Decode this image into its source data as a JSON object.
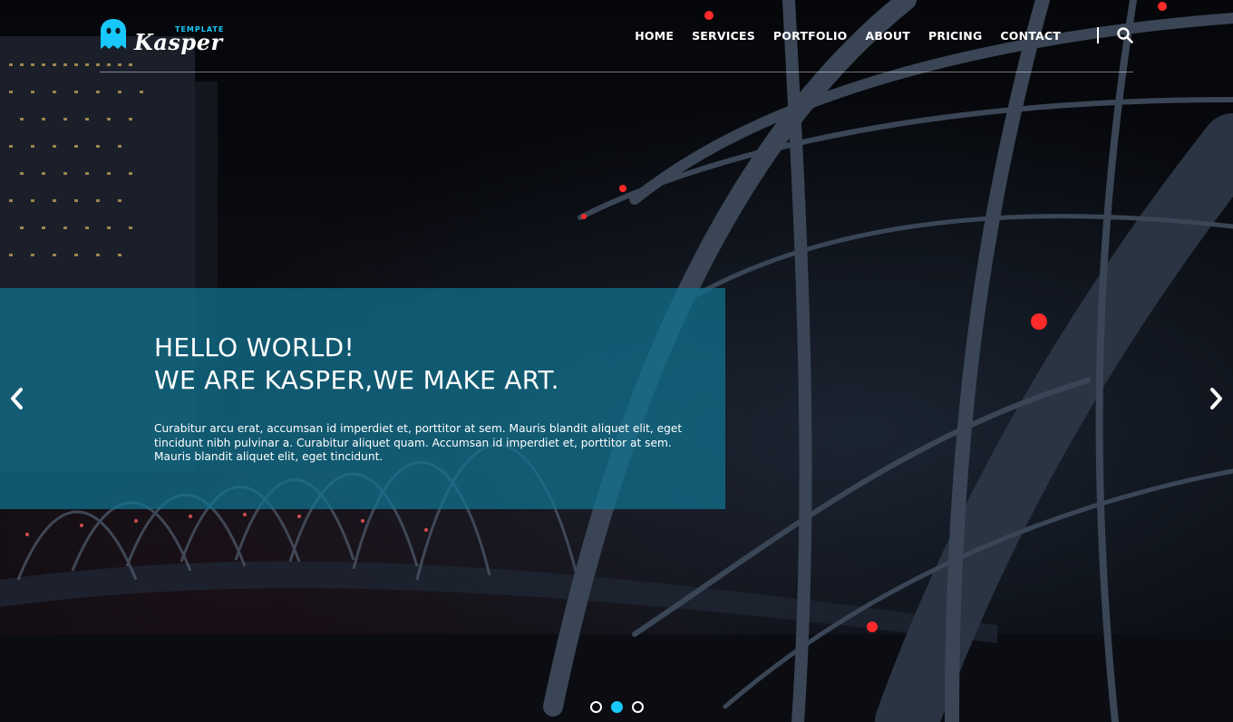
{
  "brand": {
    "name": "Kasper",
    "tagline": "TEMPLATE",
    "accent_color": "#19c8fa"
  },
  "nav": {
    "items": [
      {
        "label": "HOME"
      },
      {
        "label": "SERVICES"
      },
      {
        "label": "PORTFOLIO"
      },
      {
        "label": "ABOUT"
      },
      {
        "label": "PRICING"
      },
      {
        "label": "CONTACT"
      }
    ],
    "search_icon": "search-icon"
  },
  "hero": {
    "heading_line1": "HELLO WORLD!",
    "heading_line2": "WE ARE KASPER,WE MAKE ART.",
    "paragraph": "Curabitur arcu erat, accumsan id imperdiet et, porttitor at sem. Mauris blandit aliquet elit, eget tincidunt nibh pulvinar a. Curabitur aliquet quam. Accumsan id imperdiet et, porttitor at sem. Mauris blandit aliquet elit, eget tincidunt.",
    "box_color": "#0f7491",
    "prev_icon": "chevron-left-icon",
    "next_icon": "chevron-right-icon"
  },
  "slider": {
    "slides": 3,
    "active_index": 1
  }
}
